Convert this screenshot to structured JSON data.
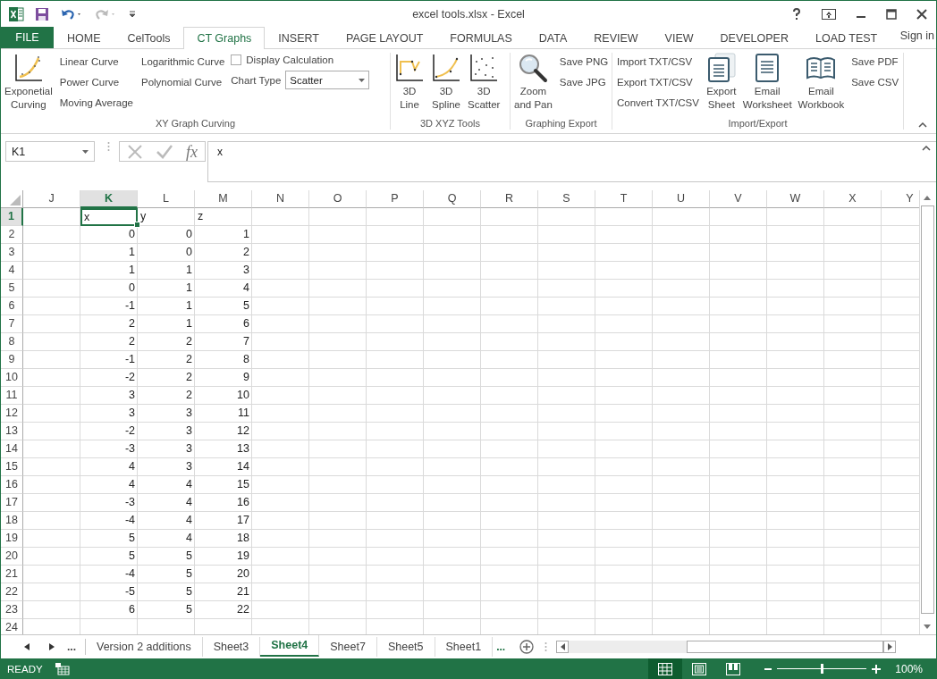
{
  "window": {
    "title": "excel tools.xlsx - Excel"
  },
  "menu_tabs": [
    {
      "label": "FILE",
      "kind": "file",
      "selected": false
    },
    {
      "label": "HOME",
      "kind": "tab",
      "selected": false
    },
    {
      "label": "CelTools",
      "kind": "tab",
      "selected": false
    },
    {
      "label": "CT Graphs",
      "kind": "tab",
      "selected": true
    },
    {
      "label": "INSERT",
      "kind": "tab",
      "selected": false
    },
    {
      "label": "PAGE LAYOUT",
      "kind": "tab",
      "selected": false
    },
    {
      "label": "FORMULAS",
      "kind": "tab",
      "selected": false
    },
    {
      "label": "DATA",
      "kind": "tab",
      "selected": false
    },
    {
      "label": "REVIEW",
      "kind": "tab",
      "selected": false
    },
    {
      "label": "VIEW",
      "kind": "tab",
      "selected": false
    },
    {
      "label": "DEVELOPER",
      "kind": "tab",
      "selected": false
    },
    {
      "label": "LOAD TEST",
      "kind": "tab",
      "selected": false
    }
  ],
  "sign_in": "Sign in",
  "ribbon": {
    "groups": [
      {
        "label": "XY Graph Curving",
        "columns": [
          [
            {
              "kind": "large",
              "lines": [
                "Exponetial",
                "Curving"
              ]
            }
          ],
          [
            {
              "kind": "small",
              "label": "Linear Curve"
            },
            {
              "kind": "small",
              "label": "Power Curve"
            },
            {
              "kind": "small",
              "label": "Moving Average"
            }
          ],
          [
            {
              "kind": "small",
              "label": "Logarithmic Curve"
            },
            {
              "kind": "small",
              "label": "Polynomial Curve"
            }
          ],
          [
            {
              "kind": "checkbox",
              "label": "Display Calculation",
              "checked": false
            },
            {
              "kind": "dropdown",
              "label": "Chart Type",
              "value": "Scatter"
            }
          ]
        ]
      },
      {
        "label": "3D XYZ Tools",
        "columns": [
          [
            {
              "kind": "large",
              "lines": [
                "3D",
                "Line"
              ]
            }
          ],
          [
            {
              "kind": "large",
              "lines": [
                "3D",
                "Spline"
              ]
            }
          ],
          [
            {
              "kind": "large",
              "lines": [
                "3D",
                "Scatter"
              ]
            }
          ]
        ]
      },
      {
        "label": "Graphing Export",
        "columns": [
          [
            {
              "kind": "large",
              "lines": [
                "Zoom",
                "and Pan"
              ]
            }
          ],
          [
            {
              "kind": "small",
              "label": "Save PNG"
            },
            {
              "kind": "small",
              "label": "Save JPG"
            }
          ]
        ]
      },
      {
        "label": "Import/Export",
        "columns": [
          [
            {
              "kind": "small",
              "label": "Import TXT/CSV"
            },
            {
              "kind": "small",
              "label": "Export TXT/CSV"
            },
            {
              "kind": "small",
              "label": "Convert TXT/CSV"
            }
          ],
          [
            {
              "kind": "large",
              "lines": [
                "Export",
                "Sheet"
              ]
            }
          ],
          [
            {
              "kind": "large",
              "lines": [
                "Email",
                "Worksheet"
              ]
            }
          ],
          [
            {
              "kind": "large",
              "lines": [
                "Email",
                "Workbook"
              ]
            }
          ],
          [
            {
              "kind": "small",
              "label": "Save PDF"
            },
            {
              "kind": "small",
              "label": "Save CSV"
            }
          ]
        ]
      }
    ]
  },
  "formula_bar": {
    "name_box": "K1",
    "function_button": "fx",
    "formula": "x"
  },
  "columns": [
    {
      "label": "J",
      "selected": false
    },
    {
      "label": "K",
      "selected": true
    },
    {
      "label": "L",
      "selected": false
    },
    {
      "label": "M",
      "selected": false
    },
    {
      "label": "N",
      "selected": false
    },
    {
      "label": "O",
      "selected": false
    },
    {
      "label": "P",
      "selected": false
    },
    {
      "label": "Q",
      "selected": false
    },
    {
      "label": "R",
      "selected": false
    },
    {
      "label": "S",
      "selected": false
    },
    {
      "label": "T",
      "selected": false
    },
    {
      "label": "U",
      "selected": false
    },
    {
      "label": "V",
      "selected": false
    },
    {
      "label": "W",
      "selected": false
    },
    {
      "label": "X",
      "selected": false
    },
    {
      "label": "Y",
      "selected": false
    }
  ],
  "rows": [
    {
      "header": "1",
      "selected": true,
      "kind": "text",
      "values": [
        "x",
        "y",
        "z"
      ]
    },
    {
      "header": "2",
      "selected": false,
      "kind": "number",
      "values": [
        "0",
        "0",
        "1"
      ]
    },
    {
      "header": "3",
      "selected": false,
      "kind": "number",
      "values": [
        "1",
        "0",
        "2"
      ]
    },
    {
      "header": "4",
      "selected": false,
      "kind": "number",
      "values": [
        "1",
        "1",
        "3"
      ]
    },
    {
      "header": "5",
      "selected": false,
      "kind": "number",
      "values": [
        "0",
        "1",
        "4"
      ]
    },
    {
      "header": "6",
      "selected": false,
      "kind": "number",
      "values": [
        "-1",
        "1",
        "5"
      ]
    },
    {
      "header": "7",
      "selected": false,
      "kind": "number",
      "values": [
        "2",
        "1",
        "6"
      ]
    },
    {
      "header": "8",
      "selected": false,
      "kind": "number",
      "values": [
        "2",
        "2",
        "7"
      ]
    },
    {
      "header": "9",
      "selected": false,
      "kind": "number",
      "values": [
        "-1",
        "2",
        "8"
      ]
    },
    {
      "header": "10",
      "selected": false,
      "kind": "number",
      "values": [
        "-2",
        "2",
        "9"
      ]
    },
    {
      "header": "11",
      "selected": false,
      "kind": "number",
      "values": [
        "3",
        "2",
        "10"
      ]
    },
    {
      "header": "12",
      "selected": false,
      "kind": "number",
      "values": [
        "3",
        "3",
        "11"
      ]
    },
    {
      "header": "13",
      "selected": false,
      "kind": "number",
      "values": [
        "-2",
        "3",
        "12"
      ]
    },
    {
      "header": "14",
      "selected": false,
      "kind": "number",
      "values": [
        "-3",
        "3",
        "13"
      ]
    },
    {
      "header": "15",
      "selected": false,
      "kind": "number",
      "values": [
        "4",
        "3",
        "14"
      ]
    },
    {
      "header": "16",
      "selected": false,
      "kind": "number",
      "values": [
        "4",
        "4",
        "15"
      ]
    },
    {
      "header": "17",
      "selected": false,
      "kind": "number",
      "values": [
        "-3",
        "4",
        "16"
      ]
    },
    {
      "header": "18",
      "selected": false,
      "kind": "number",
      "values": [
        "-4",
        "4",
        "17"
      ]
    },
    {
      "header": "19",
      "selected": false,
      "kind": "number",
      "values": [
        "5",
        "4",
        "18"
      ]
    },
    {
      "header": "20",
      "selected": false,
      "kind": "number",
      "values": [
        "5",
        "5",
        "19"
      ]
    },
    {
      "header": "21",
      "selected": false,
      "kind": "number",
      "values": [
        "-4",
        "5",
        "20"
      ]
    },
    {
      "header": "22",
      "selected": false,
      "kind": "number",
      "values": [
        "-5",
        "5",
        "21"
      ]
    },
    {
      "header": "23",
      "selected": false,
      "kind": "number",
      "values": [
        "6",
        "5",
        "22"
      ]
    },
    {
      "header": "24",
      "selected": false
    }
  ],
  "sheet_tabs": {
    "more_left": "...",
    "tabs": [
      {
        "label": "Version 2 additions",
        "selected": false
      },
      {
        "label": "Sheet3",
        "selected": false
      },
      {
        "label": "Sheet4",
        "selected": true
      },
      {
        "label": "Sheet7",
        "selected": false
      },
      {
        "label": "Sheet5",
        "selected": false
      },
      {
        "label": "Sheet1",
        "selected": false
      }
    ],
    "more_right": "..."
  },
  "status_bar": {
    "status": "READY",
    "view_buttons": [
      {
        "kind": "normal",
        "selected": true
      },
      {
        "kind": "page_layout",
        "selected": false
      },
      {
        "kind": "page_break",
        "selected": false
      }
    ],
    "zoom": {
      "level": 0.5,
      "reading": "100%"
    }
  }
}
